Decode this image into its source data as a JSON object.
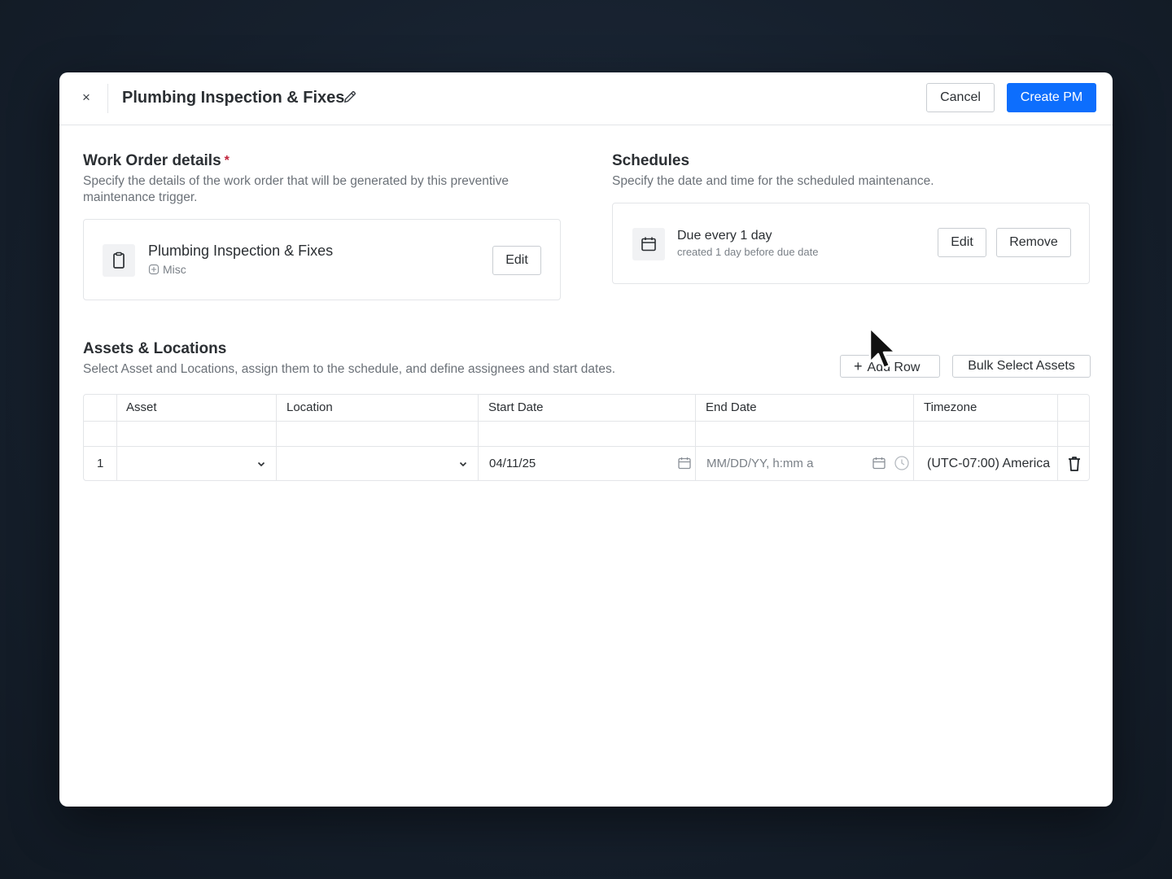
{
  "header": {
    "close_label": "×",
    "title": "Plumbing Inspection & Fixes",
    "cancel_label": "Cancel",
    "create_label": "Create PM"
  },
  "work_order": {
    "title": "Work Order details",
    "required_mark": "*",
    "description": "Specify the details of the work order that will be generated by this preventive maintenance trigger.",
    "item_title": "Plumbing Inspection & Fixes",
    "item_category": "Misc",
    "edit_label": "Edit"
  },
  "schedules": {
    "title": "Schedules",
    "description": "Specify the date and time for the scheduled maintenance.",
    "item_title": "Due every 1 day",
    "item_sub": "created 1 day before due date",
    "edit_label": "Edit",
    "remove_label": "Remove"
  },
  "assets": {
    "title": "Assets & Locations",
    "description": "Select Asset and Locations, assign them to the schedule, and define assignees and start dates.",
    "add_row_label": "Add Row",
    "bulk_select_label": "Bulk Select Assets",
    "columns": [
      "Asset",
      "Location",
      "Start Date",
      "End Date",
      "Timezone"
    ],
    "rows": [
      {
        "index": "1",
        "asset": "",
        "location": "",
        "start_date": "04/11/25",
        "end_date_placeholder": "MM/DD/YY, h:mm a",
        "timezone": "(UTC-07:00) America"
      }
    ]
  },
  "colors": {
    "primary": "#0d6efd",
    "required": "#c0233a",
    "border": "#e3e5e8"
  }
}
